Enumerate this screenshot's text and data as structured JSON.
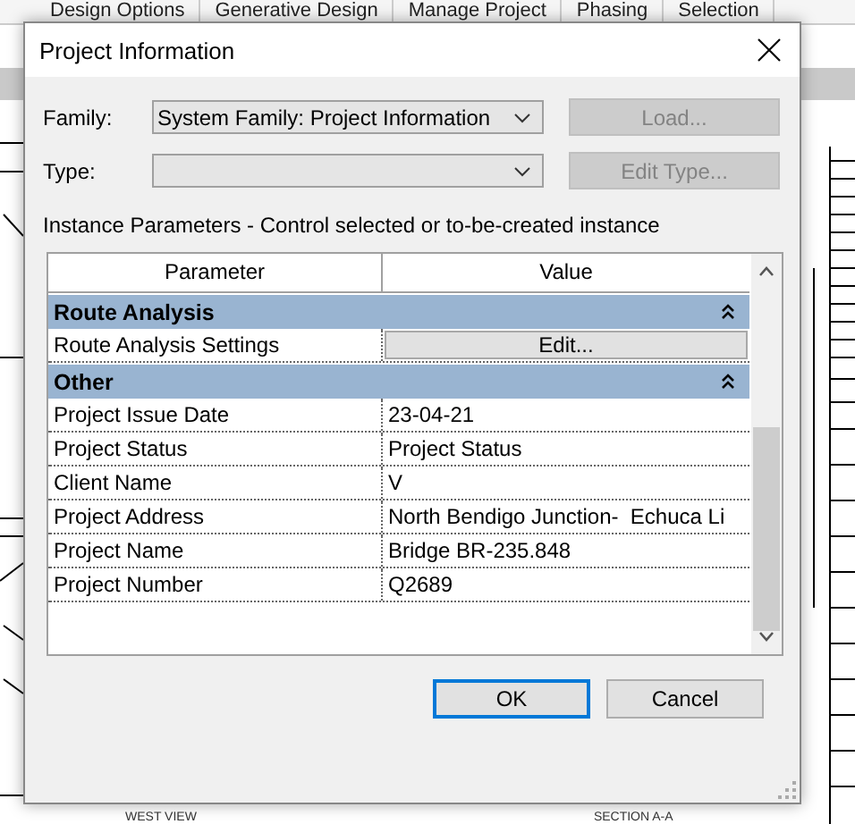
{
  "ribbon_tabs": [
    "Design Options",
    "Generative Design",
    "Manage Project",
    "Phasing",
    "Selection"
  ],
  "dialog": {
    "title": "Project Information",
    "family": {
      "label": "Family:",
      "value": "System Family: Project Information"
    },
    "load_button": {
      "label": "Load...",
      "disabled": true
    },
    "type": {
      "label": "Type:"
    },
    "edit_type_button": {
      "label": "Edit Type...",
      "disabled": true
    },
    "instance_caption": "Instance Parameters - Control selected or to-be-created instance",
    "table": {
      "columns": [
        "Parameter",
        "Value"
      ],
      "groups": [
        {
          "name": "Route Analysis",
          "expanded": true,
          "rows": [
            {
              "parameter": "Route Analysis Settings",
              "kind": "button",
              "value": "Edit..."
            }
          ]
        },
        {
          "name": "Other",
          "expanded": true,
          "rows": [
            {
              "parameter": "Project Issue Date",
              "kind": "text",
              "value": "23-04-21"
            },
            {
              "parameter": "Project Status",
              "kind": "text",
              "value": "Project Status"
            },
            {
              "parameter": "Client Name",
              "kind": "text",
              "value": "V"
            },
            {
              "parameter": "Project Address",
              "kind": "text",
              "value": "North Bendigo Junction-  Echuca Li"
            },
            {
              "parameter": "Project Name",
              "kind": "text",
              "value": "Bridge BR-235.848"
            },
            {
              "parameter": "Project Number",
              "kind": "text",
              "value": "Q2689"
            }
          ]
        }
      ]
    },
    "buttons": [
      {
        "label": "OK",
        "default": true
      },
      {
        "label": "Cancel",
        "default": false
      }
    ]
  },
  "view_labels": [
    "WEST VIEW",
    "SECTION A-A"
  ]
}
